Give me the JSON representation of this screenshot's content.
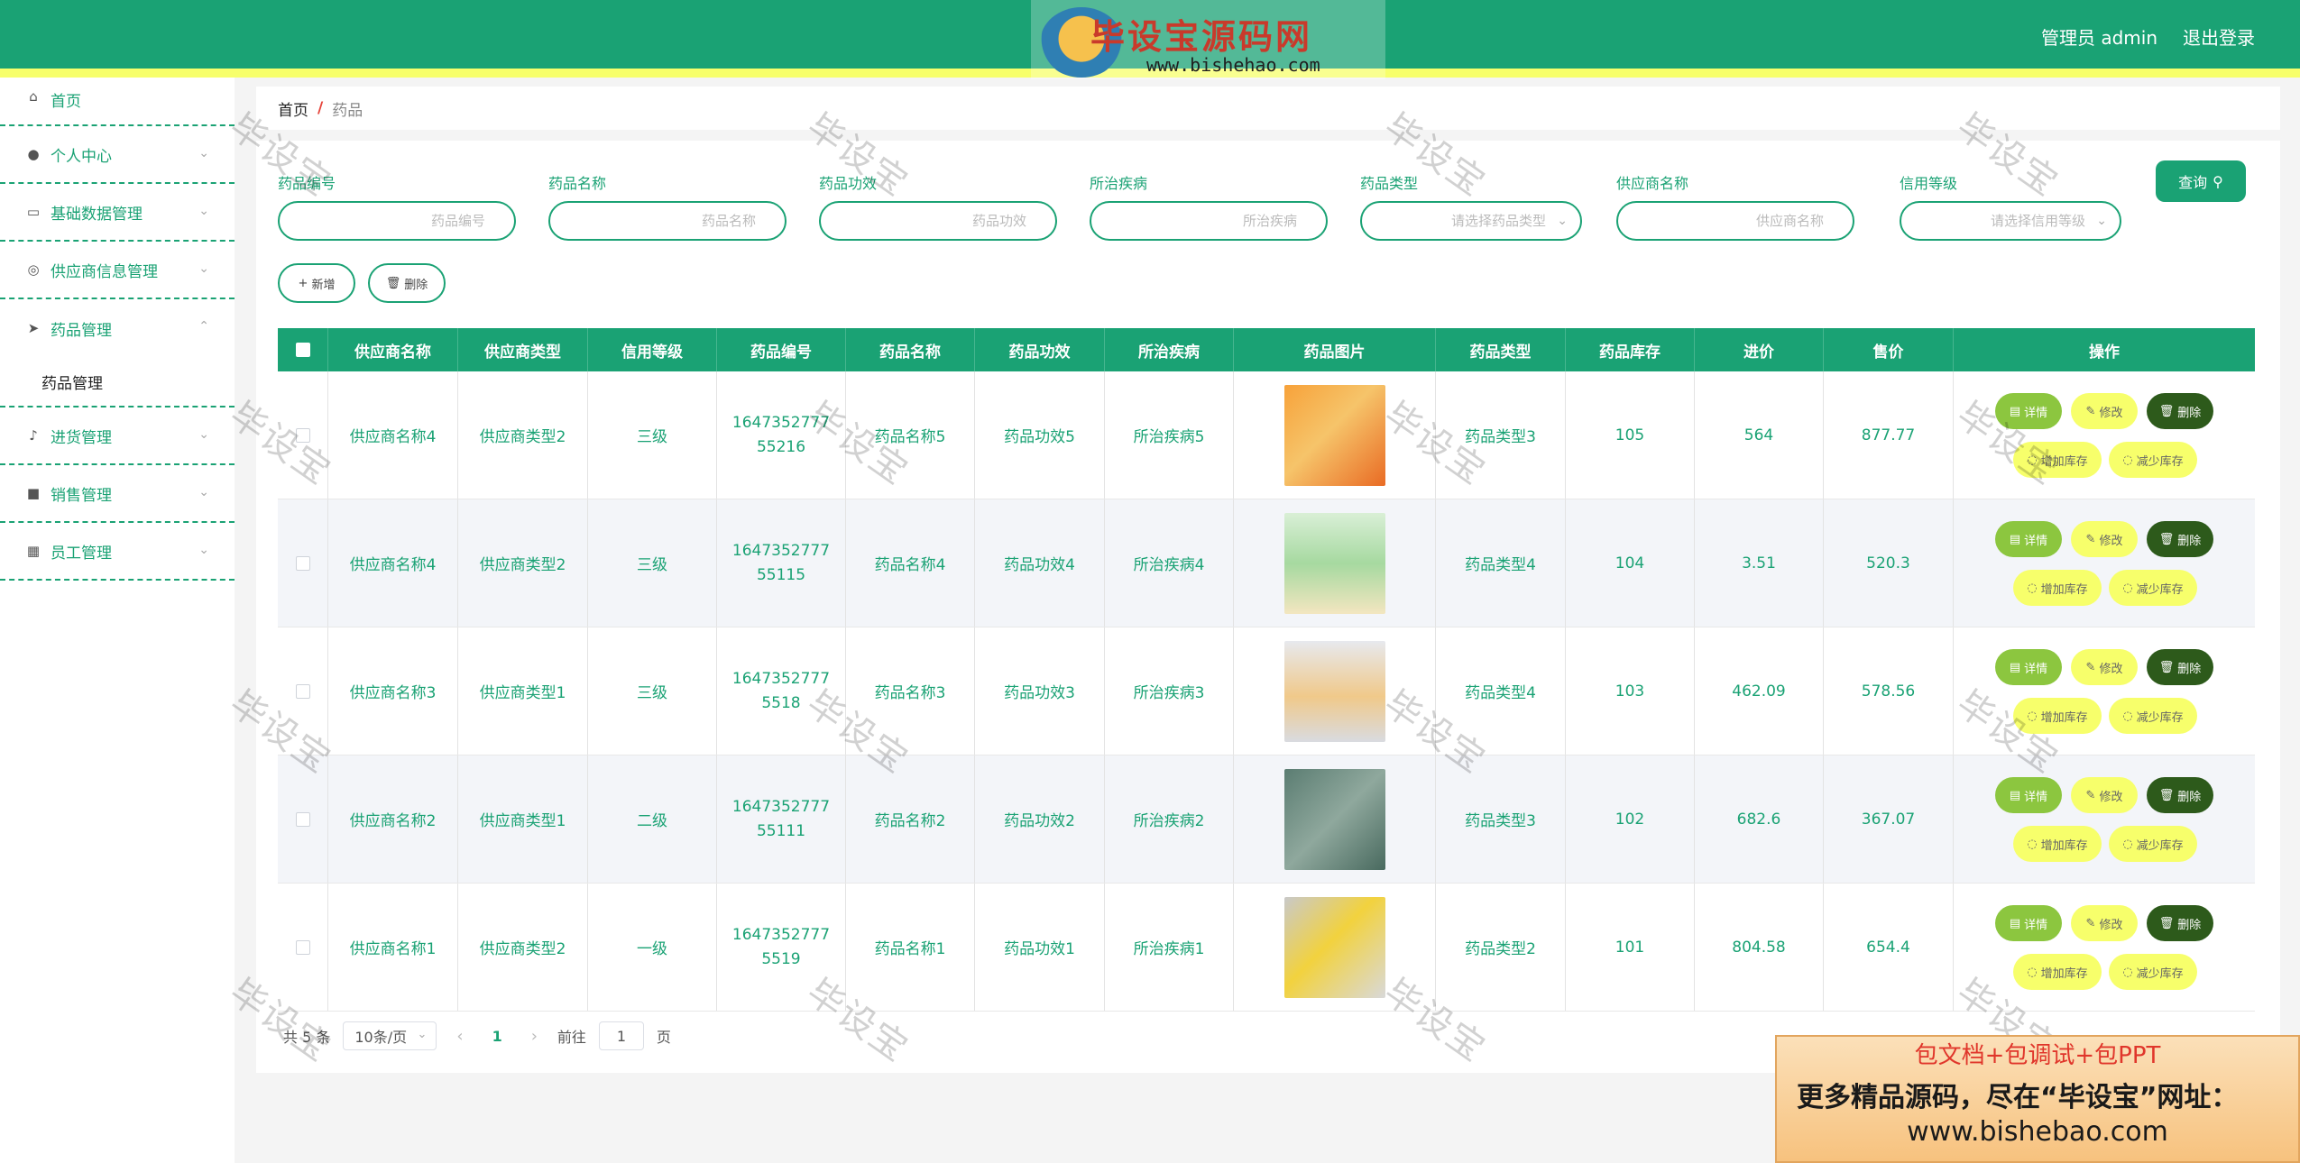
{
  "header": {
    "brand_title": "毕设宝源码网",
    "brand_url": "www.bishehao.com",
    "admin_label": "管理员 admin",
    "logout_label": "退出登录"
  },
  "sidebar": {
    "items": [
      {
        "label": "首页",
        "icon": "home-icon"
      },
      {
        "label": "个人中心",
        "icon": "user-icon"
      },
      {
        "label": "基础数据管理",
        "icon": "chat-icon"
      },
      {
        "label": "供应商信息管理",
        "icon": "compass-icon"
      },
      {
        "label": "药品管理",
        "icon": "send-icon"
      },
      {
        "label": "药品管理",
        "icon": ""
      },
      {
        "label": "进货管理",
        "icon": "mic-icon"
      },
      {
        "label": "销售管理",
        "icon": "briefcase-icon"
      },
      {
        "label": "员工管理",
        "icon": "grid-icon"
      }
    ]
  },
  "breadcrumb": {
    "home": "首页",
    "separator": "/",
    "current": "药品"
  },
  "filters": [
    {
      "label": "药品编号",
      "placeholder": "药品编号"
    },
    {
      "label": "药品名称",
      "placeholder": "药品名称"
    },
    {
      "label": "药品功效",
      "placeholder": "药品功效"
    },
    {
      "label": "所治疾病",
      "placeholder": "所治疾病"
    },
    {
      "label": "药品类型",
      "placeholder": "请选择药品类型"
    },
    {
      "label": "供应商名称",
      "placeholder": "供应商名称"
    },
    {
      "label": "信用等级",
      "placeholder": "请选择信用等级"
    }
  ],
  "query_label": "查询",
  "actions": {
    "add": "新增",
    "delete": "删除"
  },
  "table": {
    "headers": [
      "供应商名称",
      "供应商类型",
      "信用等级",
      "药品编号",
      "药品名称",
      "药品功效",
      "所治疾病",
      "药品图片",
      "药品类型",
      "药品库存",
      "进价",
      "售价",
      "操作"
    ],
    "rows": [
      {
        "supplier": "供应商名称4",
        "stype": "供应商类型2",
        "credit": "三级",
        "code": "164735277755216",
        "name": "药品名称5",
        "effect": "药品功效5",
        "disease": "所治疾病5",
        "dtype": "药品类型3",
        "stock": "105",
        "cost": "564",
        "price": "877.77"
      },
      {
        "supplier": "供应商名称4",
        "stype": "供应商类型2",
        "credit": "三级",
        "code": "164735277755115",
        "name": "药品名称4",
        "effect": "药品功效4",
        "disease": "所治疾病4",
        "dtype": "药品类型4",
        "stock": "104",
        "cost": "3.51",
        "price": "520.3"
      },
      {
        "supplier": "供应商名称3",
        "stype": "供应商类型1",
        "credit": "三级",
        "code": "16473527775518",
        "name": "药品名称3",
        "effect": "药品功效3",
        "disease": "所治疾病3",
        "dtype": "药品类型4",
        "stock": "103",
        "cost": "462.09",
        "price": "578.56"
      },
      {
        "supplier": "供应商名称2",
        "stype": "供应商类型1",
        "credit": "二级",
        "code": "164735277755111",
        "name": "药品名称2",
        "effect": "药品功效2",
        "disease": "所治疾病2",
        "dtype": "药品类型3",
        "stock": "102",
        "cost": "682.6",
        "price": "367.07"
      },
      {
        "supplier": "供应商名称1",
        "stype": "供应商类型2",
        "credit": "一级",
        "code": "16473527775519",
        "name": "药品名称1",
        "effect": "药品功效1",
        "disease": "所治疾病1",
        "dtype": "药品类型2",
        "stock": "101",
        "cost": "804.58",
        "price": "654.4"
      }
    ],
    "op_labels": {
      "detail": "详情",
      "edit": "修改",
      "del": "删除",
      "inc": "增加库存",
      "dec": "减少库存"
    }
  },
  "pager": {
    "total": "共 5 条",
    "page_size": "10条/页",
    "current_page": "1",
    "goto_prefix": "前往",
    "goto_value": "1",
    "goto_suffix": "页"
  },
  "watermark": "毕设宝",
  "ad": {
    "line1": "包文档+包调试+包PPT",
    "line2": "更多精品源码，尽在“毕设宝”网址：",
    "line3": "www.bishebao.com"
  },
  "colors": {
    "primary": "#1aa274",
    "accent_yellow": "#f7ff6b",
    "detail_green": "#8cc63f",
    "delete_dark": "#2d5a1b"
  }
}
